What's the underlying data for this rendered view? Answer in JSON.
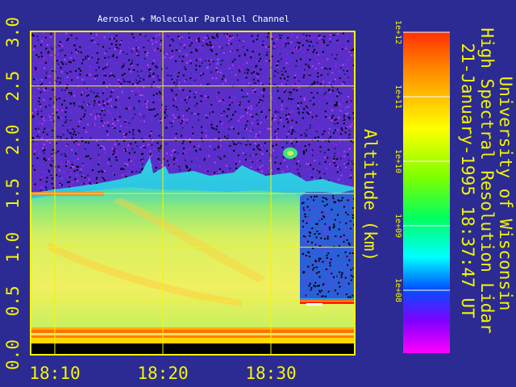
{
  "chart_data": {
    "type": "heatmap",
    "title": "Aerosol + Molecular Parallel Channel",
    "x_ticks": [
      "18:10",
      "18:20",
      "18:30"
    ],
    "y_ticks": [
      "0.0",
      "0.5",
      "1.0",
      "1.5",
      "2.0",
      "2.5",
      "3.0"
    ],
    "y_label": "Altitude (km)",
    "ylim": [
      0,
      3.0
    ],
    "colorbar_ticks": [
      "1e+12",
      "1e+11",
      "1e+10",
      "1e+09",
      "1e+08"
    ],
    "colorbar_colors": [
      "#ff3000",
      "#ff8c00",
      "#ffff00",
      "#00ff00",
      "#00ffff",
      "#0050ff",
      "#8000ff",
      "#ff00ff"
    ],
    "grid": true
  },
  "side_title": {
    "line1": "University of Wisconsin",
    "line2": "High Spectral Resolution Lidar",
    "line3": "21-January-1995 18:37:47 UT"
  },
  "colors": {
    "background": "#2b2b93",
    "frame": "#f5f500",
    "text": "#f5f500",
    "noise_dark": "#000000",
    "noise_purple": "#9a1ee6",
    "noise_blue": "#3a4adf",
    "ground": "#000000"
  }
}
